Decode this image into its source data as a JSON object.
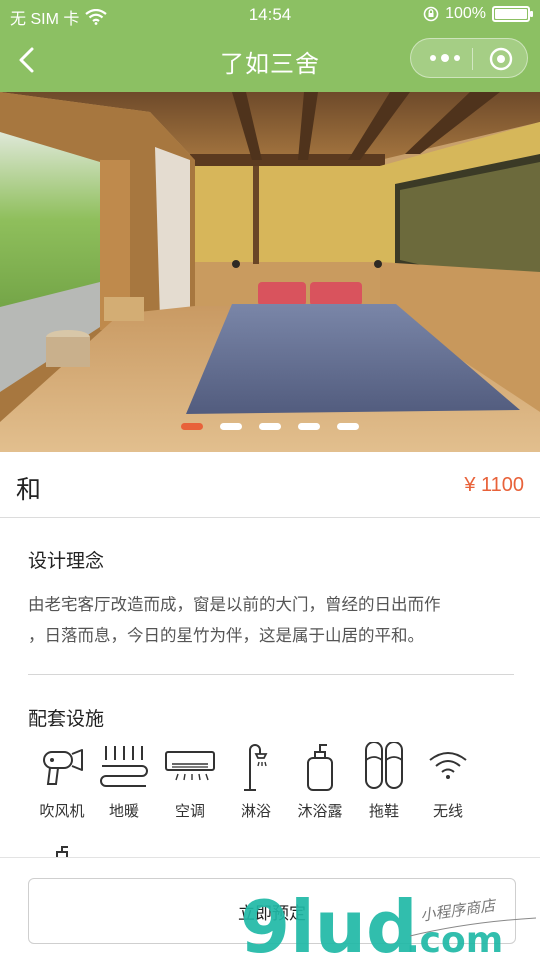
{
  "status_bar": {
    "carrier": "无 SIM 卡",
    "time": "14:54",
    "battery_percent": "100%",
    "battery_level": 1.0
  },
  "navbar": {
    "title": "了如三舍",
    "back_icon": "chevron-left-icon",
    "more_icon": "more-dots-icon",
    "close_icon": "target-circle-icon"
  },
  "carousel": {
    "image_desc_icon": "room-photo",
    "slide_count": 5,
    "active_index": 0
  },
  "room": {
    "name": "和",
    "price": "¥ 1100"
  },
  "design": {
    "title": "设计理念",
    "text_line1": "由老宅客厅改造而成，窗是以前的大门，曾经的日出而作",
    "text_line2": "，日落而息，今日的星竹为伴，这是属于山居的平和。"
  },
  "facilities": {
    "title": "配套设施",
    "items": [
      {
        "label": "吹风机",
        "icon": "hair-dryer-icon"
      },
      {
        "label": "地暖",
        "icon": "floor-heating-icon"
      },
      {
        "label": "空调",
        "icon": "air-conditioner-icon"
      },
      {
        "label": "淋浴",
        "icon": "shower-icon"
      },
      {
        "label": "沐浴露",
        "icon": "body-wash-icon"
      },
      {
        "label": "拖鞋",
        "icon": "slippers-icon"
      },
      {
        "label": "无线",
        "icon": "wifi-icon"
      }
    ]
  },
  "bottom": {
    "book_label": "立即预定"
  },
  "watermark": {
    "brand": "9lud",
    "suffix": ".com",
    "handwritten": "小程序商店"
  },
  "colors": {
    "nav_green": "#8cc063",
    "accent_orange": "#e8623a",
    "watermark_teal": "#1fb8a6"
  }
}
